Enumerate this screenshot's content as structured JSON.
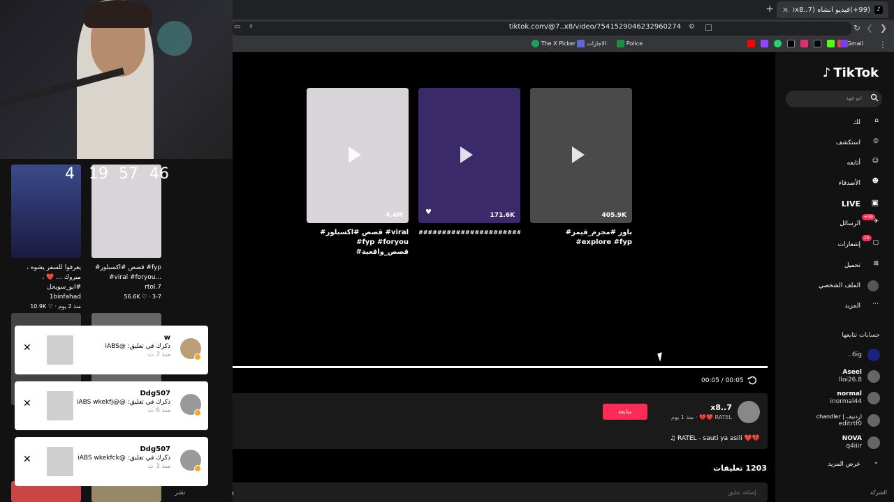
{
  "browser": {
    "tab_title": "(99+)فيديو أنشأه (x8..7@) ❤️💔 L",
    "url": "tiktok.com/@7..x8/video/7541529046232960274",
    "bookmarks": [
      "Gmail",
      "Police",
      "الاجازات",
      "The X Picker"
    ]
  },
  "sidebar": {
    "logo": "TikTok",
    "search_placeholder": "ابو فهد",
    "nav": [
      {
        "label": "لك",
        "icon": "home-icon"
      },
      {
        "label": "استكشف",
        "icon": "compass-icon"
      },
      {
        "label": "أتابعه",
        "icon": "user-follow-icon"
      },
      {
        "label": "الأصدقاء",
        "icon": "friends-icon"
      },
      {
        "label": "LIVE",
        "icon": "live-icon"
      },
      {
        "label": "الرسائل",
        "icon": "messages-icon",
        "badge": "99+"
      },
      {
        "label": "إشعارات",
        "icon": "inbox-icon",
        "badge": "15"
      },
      {
        "label": "تحميل",
        "icon": "upload-icon"
      },
      {
        "label": "الملف الشخصي",
        "icon": "profile-icon"
      },
      {
        "label": "المزيد",
        "icon": "more-icon"
      }
    ],
    "following_title": "حسابات تتابعها",
    "accounts": [
      {
        "line1": "",
        "line2": "6ig.."
      },
      {
        "line1": "Aseel",
        "line2": "lloi26.8"
      },
      {
        "line1": "normal",
        "line2": "inormal44"
      },
      {
        "line1": "اردنيف | chandler",
        "line2": "editrtf0"
      },
      {
        "line1": "NOVA",
        "line2": "q4iiir"
      }
    ],
    "see_more": "عرض المزيد",
    "company": "الشركة"
  },
  "videos": [
    {
      "views": "405.9K",
      "caption": "#باور #مجرم_قيمز #explore #fyp",
      "color": "#4a4a4a"
    },
    {
      "views": "171.6K",
      "caption": "##########################",
      "color": "#3a2a6a"
    },
    {
      "views": "4.4M",
      "caption": "#قصص #اكسبلور #viral #fyp #foryou #قصص_واقعية",
      "color": "#d8d4d8"
    }
  ],
  "player": {
    "time": "00:05 / 00:05"
  },
  "author": {
    "name": "x8..7",
    "sub": "RATEL ❤️💔 · منذ 1 يوم",
    "follow": "متابعة",
    "music": "♫ RATEL - sauti ya asili ❤️💔"
  },
  "comments": {
    "count": "1203 تعليقات",
    "placeholder": "إضافة تعليق..."
  },
  "overlay": {
    "counts": [
      "4",
      "19",
      "57",
      "46"
    ],
    "thumb_captions": [
      {
        "text": "يعرفوا للسفر يشوه ، مبروك ... ❤️ . #ابو_سويحل",
        "user": "1binfahad",
        "meta": "10.9K ♡ · منذ 2 يوم"
      },
      {
        "text": "#قصص #اكسبلور #fyp #viral #foryou...",
        "user": "rtol.7",
        "meta": "56.6K ♡ · 3-7"
      }
    ],
    "post_label": "نشر"
  },
  "notifications": [
    {
      "user": "w",
      "text": "ذكرك في تعليق: @iABS",
      "time": "منذ 7 ث"
    },
    {
      "user": "Ddg507",
      "text": "ذكرك في تعليق: @@iABS wkekfj",
      "time": "منذ 6 ث"
    },
    {
      "user": "Ddg507",
      "text": "ذكرك في تعليق: @iABS wkekfck",
      "time": "منذ 3 ث"
    }
  ]
}
